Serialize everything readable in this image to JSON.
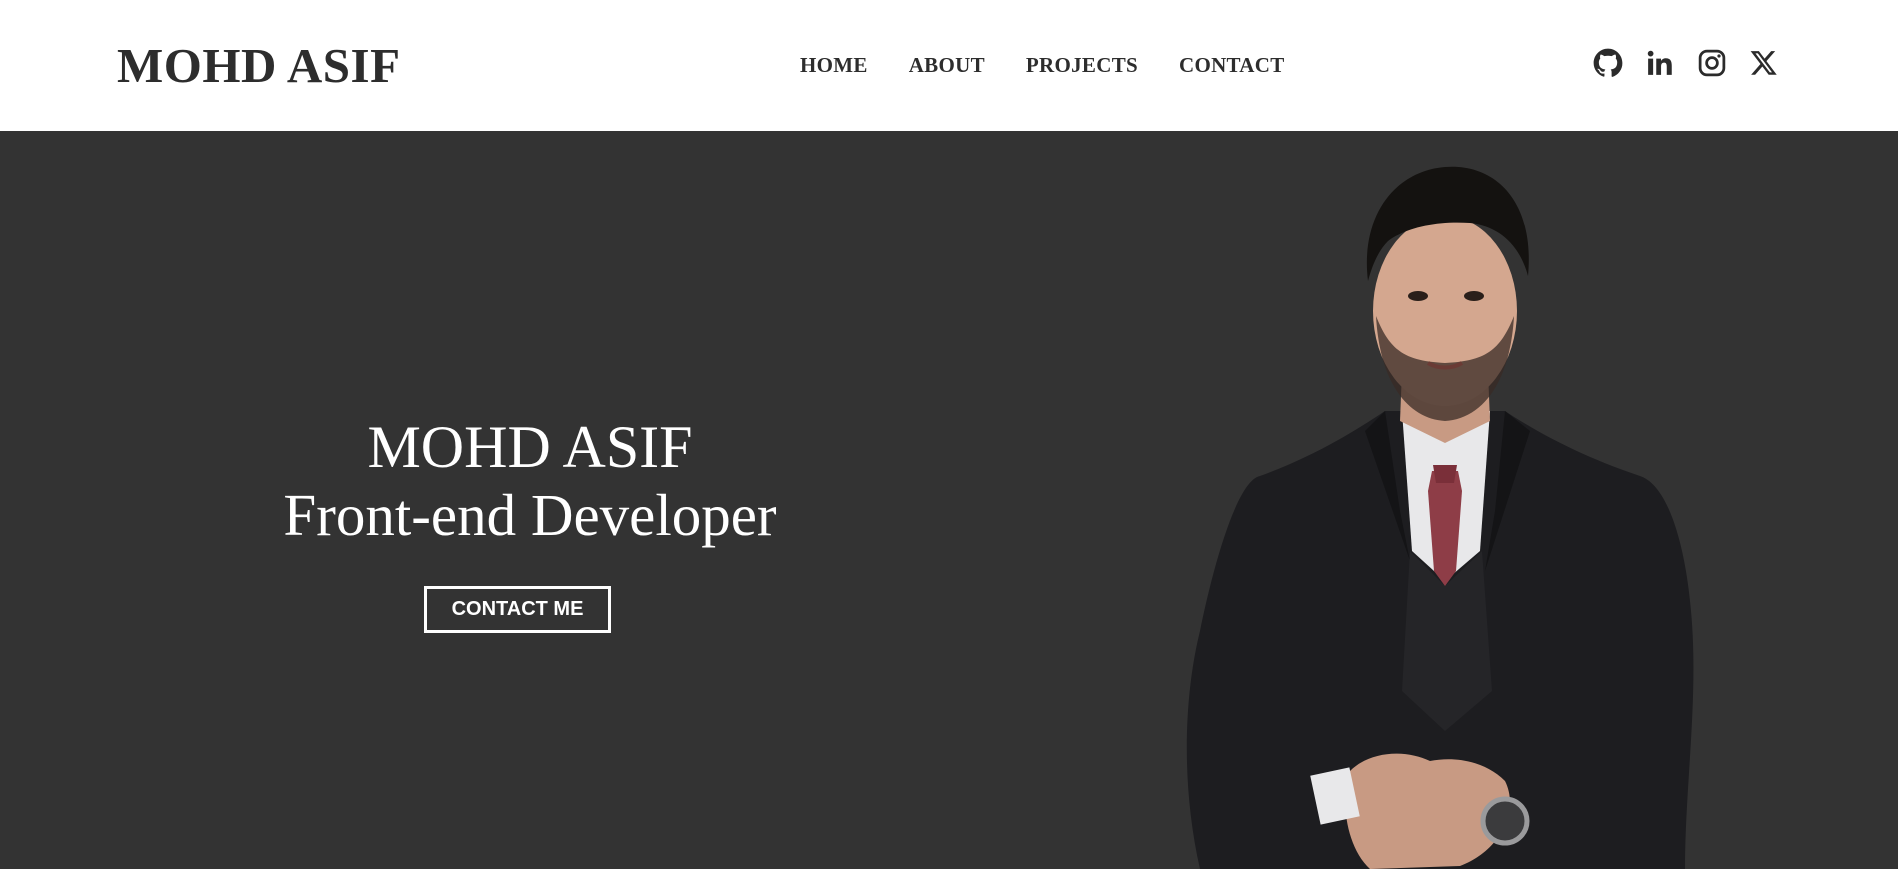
{
  "header": {
    "brand": "MOHD ASIF",
    "nav": [
      {
        "label": "HOME"
      },
      {
        "label": "ABOUT"
      },
      {
        "label": "PROJECTS"
      },
      {
        "label": "CONTACT"
      }
    ],
    "socials": [
      {
        "icon": "github-icon"
      },
      {
        "icon": "linkedin-icon"
      },
      {
        "icon": "instagram-icon"
      },
      {
        "icon": "x-twitter-icon"
      }
    ]
  },
  "hero": {
    "name": "MOHD ASIF",
    "role": "Front-end Developer",
    "cta_label": "CONTACT ME",
    "portrait": "portrait-photo"
  },
  "colors": {
    "header_bg": "#ffffff",
    "hero_bg": "#333333",
    "text_dark": "#2d2d2d",
    "text_light": "#ffffff"
  }
}
